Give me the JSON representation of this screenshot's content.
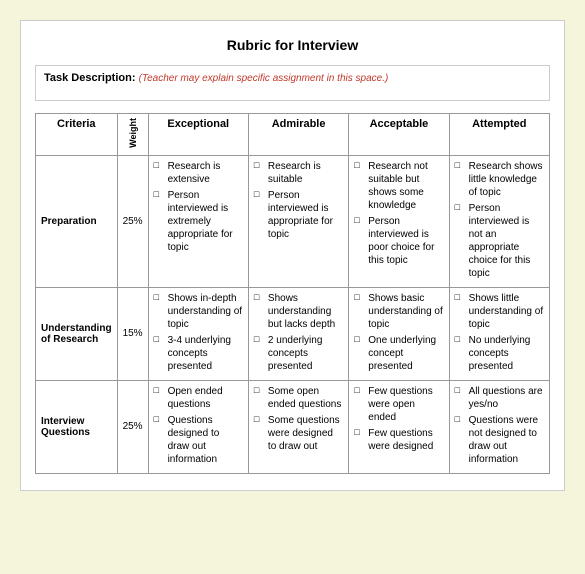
{
  "title": "Rubric for Interview",
  "taskDesc": {
    "label": "Task Description:",
    "placeholder": "(Teacher may explain specific assignment in this space.)"
  },
  "headers": {
    "criteria": "Criteria",
    "weight": "Weight",
    "exceptional": "Exceptional",
    "admirable": "Admirable",
    "acceptable": "Acceptable",
    "attempted": "Attempted"
  },
  "rows": [
    {
      "criteria": "Preparation",
      "weight": "25%",
      "exceptional": [
        "Research is extensive",
        "Person interviewed is extremely appropriate for topic"
      ],
      "admirable": [
        "Research is suitable",
        "Person interviewed is appropriate for topic"
      ],
      "acceptable": [
        "Research not suitable but shows some knowledge",
        "Person interviewed is poor choice for this topic"
      ],
      "attempted": [
        "Research shows little knowledge of topic",
        "Person interviewed is not an appropriate choice for this topic"
      ]
    },
    {
      "criteria": "Understanding of Research",
      "weight": "15%",
      "exceptional": [
        "Shows in-depth understanding of topic",
        "3-4 underlying concepts presented"
      ],
      "admirable": [
        "Shows understanding but lacks depth",
        "2 underlying concepts presented"
      ],
      "acceptable": [
        "Shows basic understanding of topic",
        "One underlying concept presented"
      ],
      "attempted": [
        "Shows little understanding of topic",
        "No underlying concepts presented"
      ]
    },
    {
      "criteria": "Interview Questions",
      "weight": "25%",
      "exceptional": [
        "Open ended questions",
        "Questions designed to draw out information"
      ],
      "admirable": [
        "Some open ended questions",
        "Some questions were designed to draw out"
      ],
      "acceptable": [
        "Few questions were open ended",
        "Few questions were designed"
      ],
      "attempted": [
        "All questions are yes/no",
        "Questions were not designed to draw out information"
      ]
    }
  ]
}
